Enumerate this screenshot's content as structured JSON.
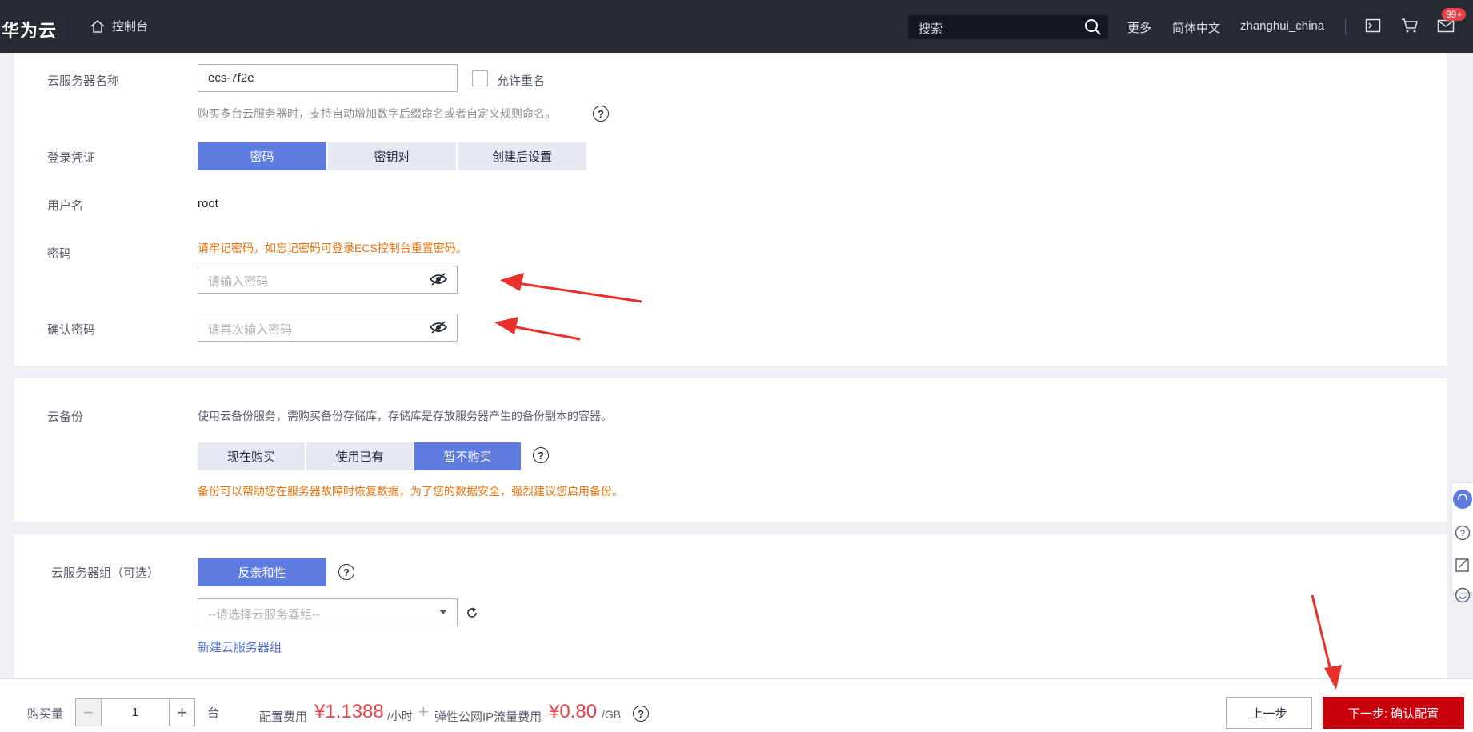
{
  "topbar": {
    "brand": "华为云",
    "console": "控制台",
    "search_placeholder": "搜索",
    "more": "更多",
    "language": "简体中文",
    "user": "zhanghui_china",
    "badge": "99+"
  },
  "form": {
    "server_name_label": "云服务器名称",
    "server_name_value": "ecs-7f2e",
    "allow_duplicate": "允许重名",
    "naming_hint": "购买多台云服务器时，支持自动增加数字后缀命名或者自定义规则命名。",
    "login_label": "登录凭证",
    "login_options": [
      "密码",
      "密钥对",
      "创建后设置"
    ],
    "username_label": "用户名",
    "username_value": "root",
    "password_label": "密码",
    "password_warning": "请牢记密码，如忘记密码可登录ECS控制台重置密码。",
    "password_placeholder": "请输入密码",
    "confirm_label": "确认密码",
    "confirm_placeholder": "请再次输入密码"
  },
  "backup": {
    "label": "云备份",
    "description": "使用云备份服务，需购买备份存储库，存储库是存放服务器产生的备份副本的容器。",
    "options": [
      "现在购买",
      "使用已有",
      "暂不购买"
    ],
    "warning": "备份可以帮助您在服务器故障时恢复数据，为了您的数据安全，强烈建议您启用备份。"
  },
  "group": {
    "label": "云服务器组（可选）",
    "policy": "反亲和性",
    "select_placeholder": "--请选择云服务器组--",
    "create_link": "新建云服务器组"
  },
  "bottom": {
    "qty_label": "购买量",
    "qty_value": "1",
    "qty_unit": "台",
    "config_fee_label": "配置费用",
    "config_price": "¥1.1388",
    "config_unit": "/小时",
    "ip_fee_label": "弹性公网IP流量费用",
    "ip_price": "¥0.80",
    "ip_unit": "/GB",
    "prev": "上一步",
    "next": "下一步: 确认配置"
  },
  "colors": {
    "primary": "#5e7ce0",
    "danger": "#c7000b",
    "price": "#e6424a",
    "warning": "#e8720c",
    "annotation": "#e8312a"
  }
}
